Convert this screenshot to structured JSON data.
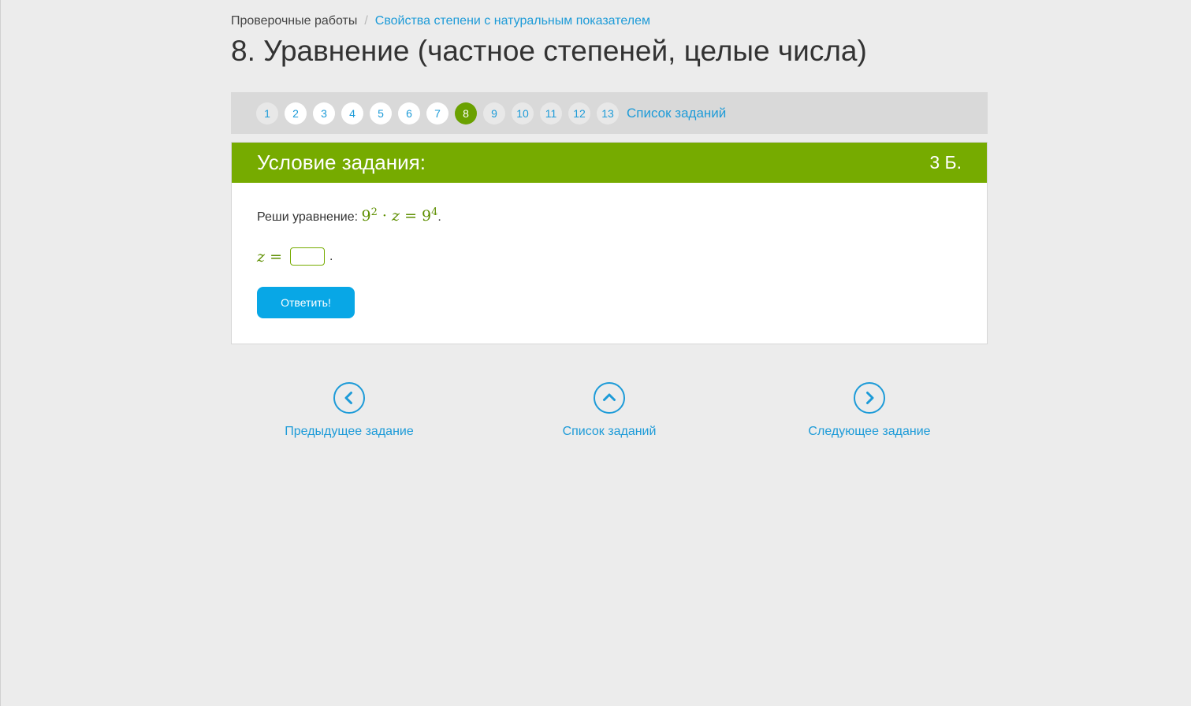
{
  "breadcrumb": {
    "root": "Проверочные работы",
    "separator": "/",
    "current": "Свойства степени с натуральным показателем"
  },
  "page_title": "8. Уравнение (частное степеней, целые числа)",
  "pager": {
    "pages": [
      "1",
      "2",
      "3",
      "4",
      "5",
      "6",
      "7",
      "8",
      "9",
      "10",
      "11",
      "12",
      "13"
    ],
    "active_page": "8",
    "list_label": "Список заданий"
  },
  "task": {
    "header_title": "Условие задания:",
    "points": "3 Б.",
    "question_prefix": "Реши уравнение: ",
    "equation": {
      "base1": "9",
      "exp1": "2",
      "op": "·",
      "variable": "z",
      "eq": "=",
      "base2": "9",
      "exp2": "4",
      "end": "."
    },
    "answer": {
      "variable": "z",
      "eq": "=",
      "value": "",
      "end": "."
    },
    "submit_label": "Ответить!"
  },
  "nav": {
    "prev_label": "Предыдущее задание",
    "list_label": "Список заданий",
    "next_label": "Следующее задание"
  },
  "colors": {
    "accent_green": "#76ab00",
    "active_page": "#6aa100",
    "link_blue": "#1d9bd8",
    "button_blue": "#08a7e6",
    "background": "#ececec"
  }
}
